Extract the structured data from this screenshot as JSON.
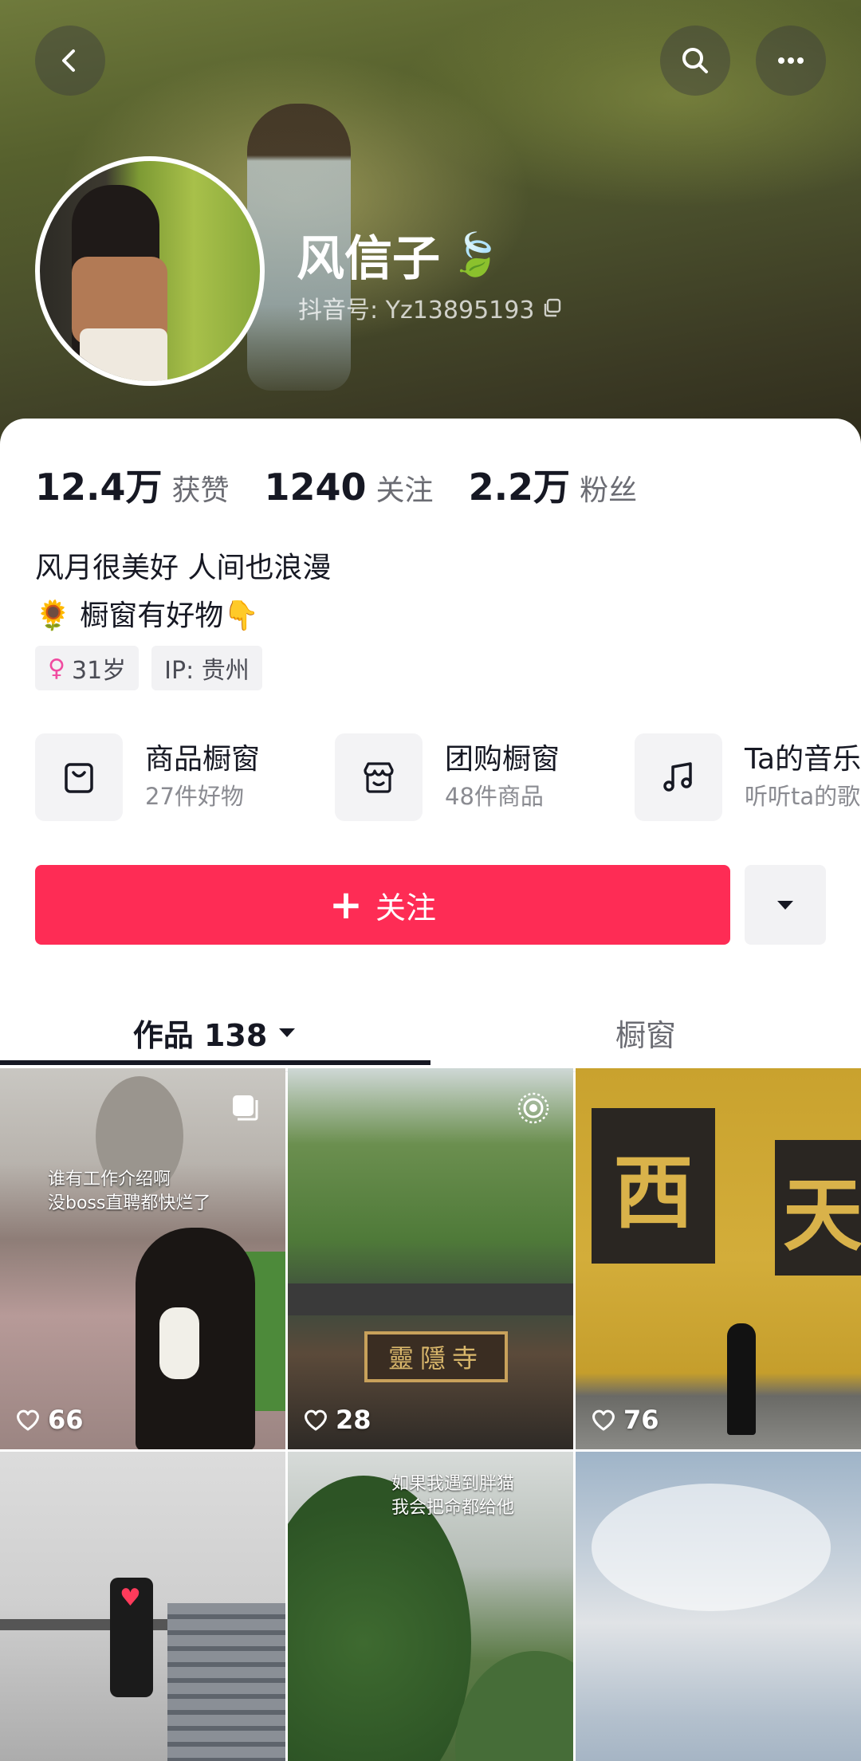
{
  "header": {
    "profile_name": "风信子",
    "name_emoji": "🍃",
    "douyin_id": "抖音号: Yz13895193"
  },
  "stats": [
    {
      "value": "12.4万",
      "label": "获赞"
    },
    {
      "value": "1240",
      "label": "关注"
    },
    {
      "value": "2.2万",
      "label": "粉丝"
    }
  ],
  "bio": {
    "line1": "风月很美好 人间也浪漫",
    "line2": "🌻 橱窗有好物👇"
  },
  "tags": {
    "age": "31岁",
    "gender_icon": "female-icon",
    "ip": "IP: 贵州"
  },
  "tools": [
    {
      "title": "商品橱窗",
      "subtitle": "27件好物",
      "icon": "shopping-bag-icon"
    },
    {
      "title": "团购橱窗",
      "subtitle": "48件商品",
      "icon": "store-icon"
    },
    {
      "title": "Ta的音乐",
      "subtitle": "听听ta的歌",
      "icon": "music-note-icon"
    }
  ],
  "actions": {
    "follow_label": "关注",
    "follow_plus": "+"
  },
  "tabs": {
    "works_label": "作品 138",
    "showcase_label": "橱窗"
  },
  "videos": [
    {
      "likes": "66",
      "caption": "谁有工作介绍啊\n没boss直聘都快烂了",
      "badge": "multi-image-icon"
    },
    {
      "likes": "28",
      "plaque": "靈隱寺",
      "badge": "live-photo-icon"
    },
    {
      "likes": "76",
      "panel1": "西",
      "panel2": "天"
    },
    {
      "likes": ""
    },
    {
      "likes": "",
      "caption": "如果我遇到胖猫\n我会把命都给他"
    },
    {
      "likes": ""
    }
  ],
  "colors": {
    "accent": "#fe2c55",
    "text_primary": "#161823",
    "text_secondary": "#6b6c73"
  }
}
